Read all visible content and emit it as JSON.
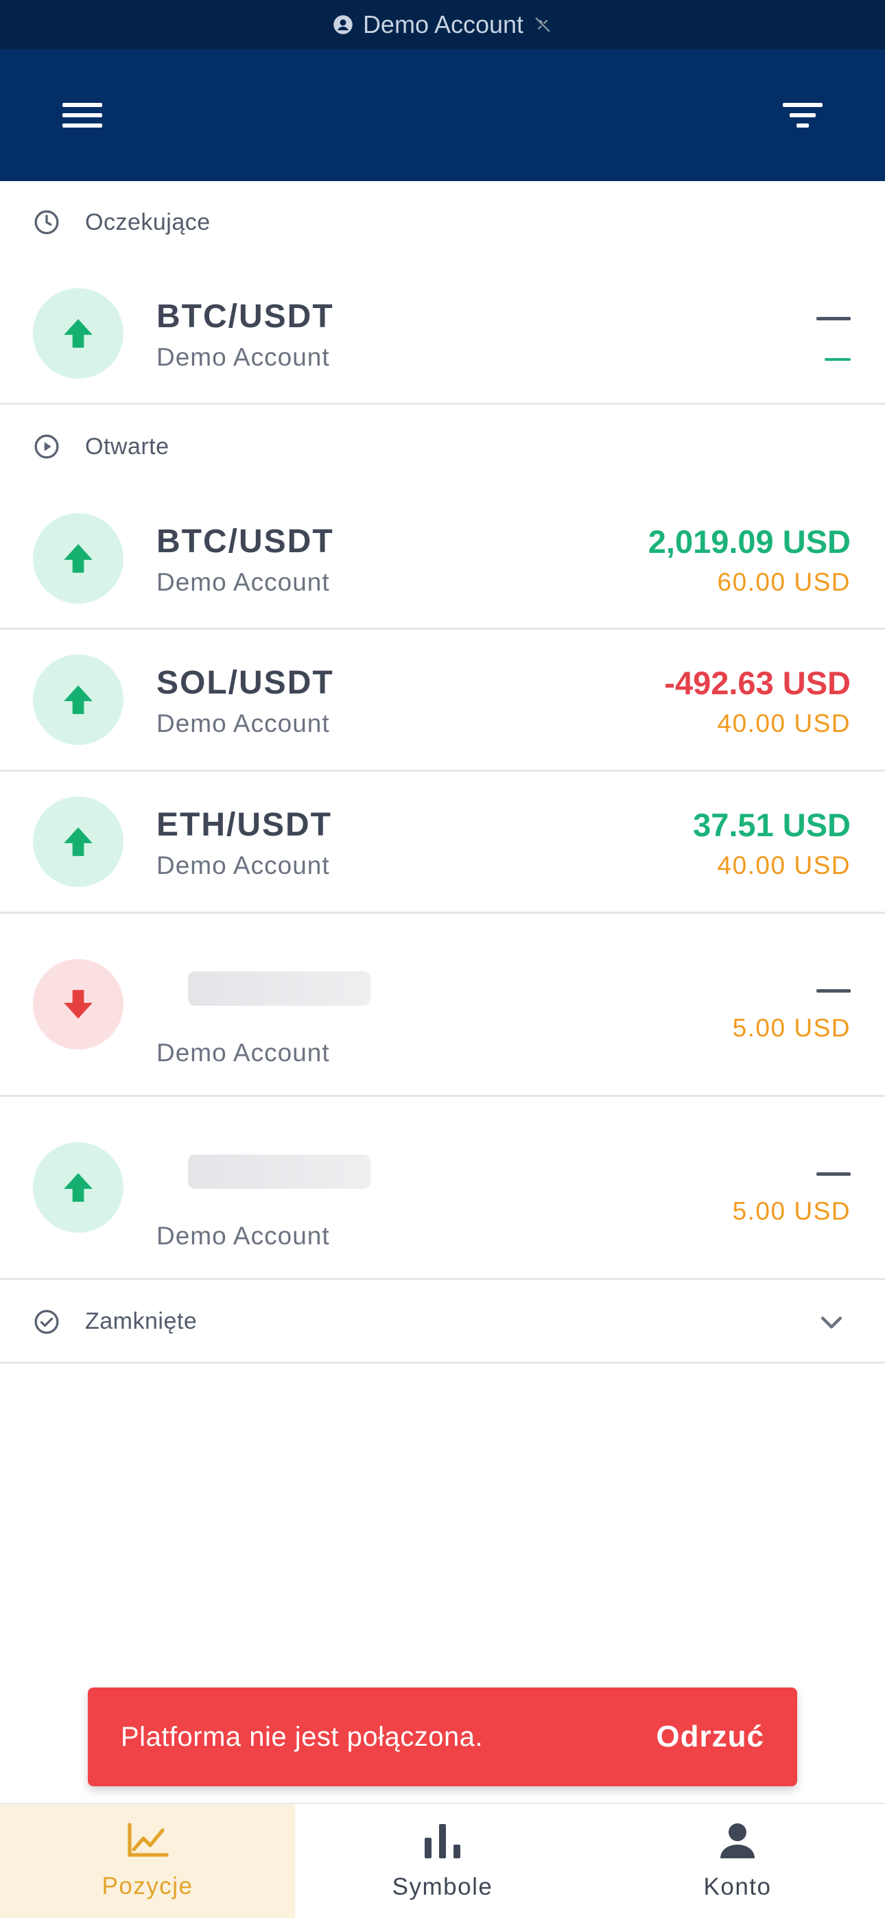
{
  "statusbar": {
    "label": "Demo Account",
    "user_icon": "user-circle-icon",
    "connection_icon": "disconnected-icon"
  },
  "appbar": {
    "menu_icon": "hamburger-menu-icon",
    "filter_icon": "filter-icon"
  },
  "sections": {
    "pending": {
      "title": "Oczekujące",
      "icon": "clock-icon"
    },
    "open": {
      "title": "Otwarte",
      "icon": "play-circle-icon"
    },
    "closed": {
      "title": "Zamknięte",
      "icon": "check-circle-icon"
    }
  },
  "pending_rows": [
    {
      "symbol": "BTC/USDT",
      "account": "Demo Account",
      "direction": "up",
      "pnl": "",
      "margin": ""
    }
  ],
  "open_rows": [
    {
      "symbol": "BTC/USDT",
      "account": "Demo Account",
      "direction": "up",
      "pnl": "2,019.09 USD",
      "pnl_sign": "positive",
      "margin": "60.00 USD"
    },
    {
      "symbol": "SOL/USDT",
      "account": "Demo Account",
      "direction": "up",
      "pnl": "-492.63 USD",
      "pnl_sign": "negative",
      "margin": "40.00 USD"
    },
    {
      "symbol": "ETH/USDT",
      "account": "Demo Account",
      "direction": "up",
      "pnl": "37.51 USD",
      "pnl_sign": "positive",
      "margin": "40.00 USD"
    },
    {
      "symbol": "",
      "account": "Demo Account",
      "direction": "down",
      "pnl": "",
      "margin": "5.00 USD"
    },
    {
      "symbol": "",
      "account": "Demo Account",
      "direction": "up",
      "pnl": "",
      "margin": "5.00 USD"
    }
  ],
  "toast": {
    "message": "Platforma nie jest połączona.",
    "action": "Odrzuć"
  },
  "tabs": [
    {
      "label": "Pozycje",
      "icon": "line-chart-icon",
      "active": true
    },
    {
      "label": "Symbole",
      "icon": "bar-chart-icon",
      "active": false
    },
    {
      "label": "Konto",
      "icon": "person-icon",
      "active": false
    }
  ],
  "colors": {
    "positive": "#1bb37a",
    "negative": "#e6414a",
    "margin": "#f29a1e",
    "header": "#032f66",
    "accent": "#e3a42c"
  }
}
